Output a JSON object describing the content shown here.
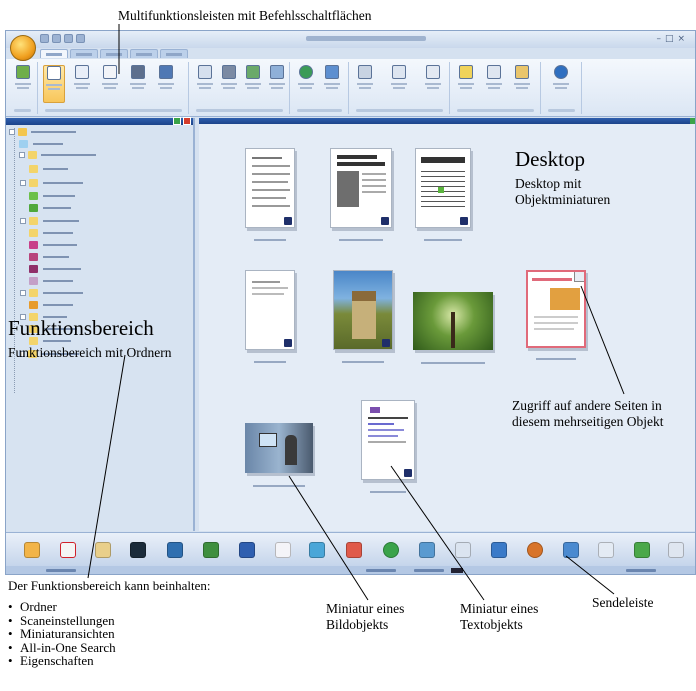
{
  "annotations": {
    "ribbon": "Multifunktionsleisten mit Befehlsschaltflächen",
    "desktop_title": "Desktop",
    "desktop_sub": "Desktop mit Objektminiaturen",
    "function_title": "Funktionsbereich",
    "function_sub": "Funktionsbereich mit Ordnern",
    "access_note": "Zugriff auf andere Seiten in diesem mehrseitigen Objekt",
    "function_can_contain": "Der Funktionsbereich kann beinhalten:",
    "function_items": [
      "Ordner",
      "Scaneinstellungen",
      "Miniaturansichten",
      "All-in-One Search",
      "Eigenschaften"
    ],
    "caption_image": "Miniatur eines Bildobjekts",
    "caption_text": "Miniatur eines Textobjekts",
    "caption_sendbar": "Sendeleiste"
  },
  "colors": {
    "window_bg": "#d5e1f0",
    "pane_header": "#1b438a",
    "accent_orange": "#f0a020"
  },
  "icons": {
    "app_button": "app-orb-icon",
    "pane_close": "close-icon",
    "pane_pin": "pin-icon",
    "page_nav": "page-flip-icon"
  }
}
